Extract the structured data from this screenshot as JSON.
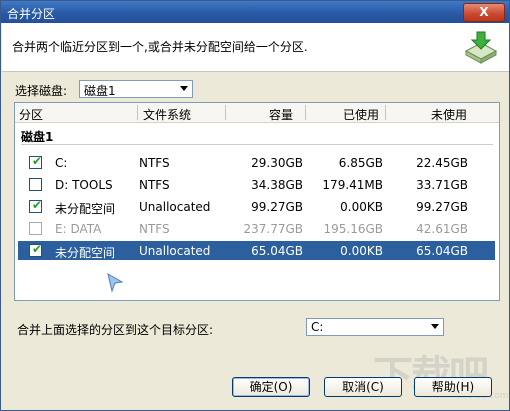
{
  "window": {
    "title": "合并分区",
    "close_label": "X"
  },
  "header": {
    "description": "合并两个临近分区到一个,或合并未分配空间给一个分区."
  },
  "disk_select": {
    "label": "选择磁盘:",
    "value": "磁盘1"
  },
  "list": {
    "columns": [
      "分区",
      "文件系统",
      "容量",
      "已使用",
      "未使用"
    ],
    "group": "磁盘1",
    "rows": [
      {
        "name": "C:",
        "fs": "NTFS",
        "capacity": "29.30GB",
        "used": "6.85GB",
        "free": "22.45GB",
        "checked": true
      },
      {
        "name": "D:  TOOLS",
        "fs": "NTFS",
        "capacity": "34.38GB",
        "used": "179.41MB",
        "free": "33.71GB",
        "checked": false
      },
      {
        "name": "未分配空间",
        "fs": "Unallocated",
        "capacity": "99.27GB",
        "used": "0.00KB",
        "free": "99.27GB",
        "checked": true
      },
      {
        "name": "E:  DATA",
        "fs": "NTFS",
        "capacity": "237.77GB",
        "used": "195.16GB",
        "free": "42.61GB",
        "checked": false
      },
      {
        "name": "未分配空间",
        "fs": "Unallocated",
        "capacity": "65.04GB",
        "used": "0.00KB",
        "free": "65.04GB",
        "checked": true
      }
    ]
  },
  "target": {
    "label": "合并上面选择的分区到这个目标分区:",
    "value": "C:"
  },
  "buttons": {
    "ok": "确定(O)",
    "cancel": "取消(C)",
    "help": "帮助(H)"
  },
  "watermark": {
    "text": "下载吧",
    "sub": "www.xiazaiba.com"
  },
  "colors": {
    "selection": "#2c5f9e",
    "title": "#2a5aa6",
    "check": "#21a121"
  }
}
